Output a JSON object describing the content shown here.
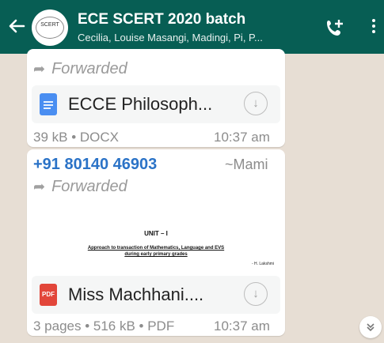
{
  "header": {
    "title": "ECE SCERT 2020 batch",
    "subtitle": "Cecilia, Louise Masangi, Madingi, Pi, P...",
    "avatar_text": "SCERT",
    "back_icon": "arrow-left-icon",
    "call_icon": "add-call-icon",
    "menu_icon": "more-vertical-icon",
    "bar_color": "#075e54"
  },
  "messages": [
    {
      "forwarded_label": "Forwarded",
      "doc_name": "ECCE Philosoph...",
      "doc_type_icon": "docx-icon",
      "meta": "39 kB • DOCX",
      "time": "10:37 am"
    },
    {
      "sender_phone": "+91 80140 46903",
      "sender_name": "~Mami",
      "forwarded_label": "Forwarded",
      "preview": {
        "heading": "UNIT – I",
        "line1": "Approach to transaction of Mathematics, Language and EVS",
        "line2": "during early primary grades",
        "author": "- H. Lakshmi"
      },
      "doc_type_icon": "pdf-icon",
      "pdf_badge": "PDF",
      "doc_name": "Miss Machhani....",
      "meta": "3 pages • 516 kB • PDF",
      "time": "10:37 am"
    }
  ],
  "scroll_icon": "double-chevron-down-icon"
}
